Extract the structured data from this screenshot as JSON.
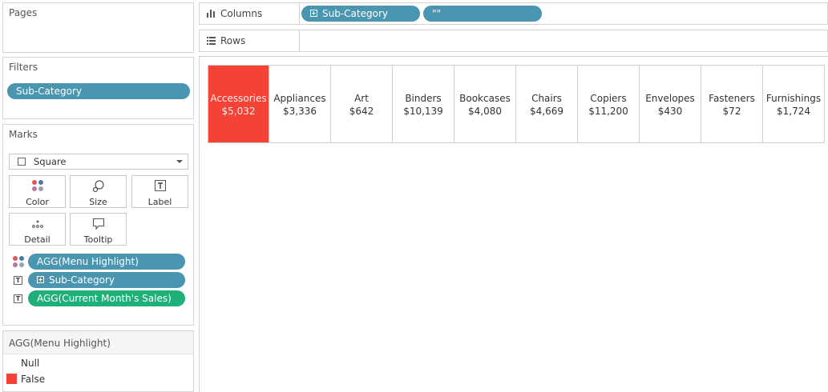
{
  "colors": {
    "pill_blue": "#4a95b0",
    "pill_green": "#1fb079",
    "highlight_red": "#f44336"
  },
  "pages": {
    "title": "Pages"
  },
  "filters": {
    "title": "Filters",
    "pills": [
      {
        "label": "Sub-Category"
      }
    ]
  },
  "marks": {
    "title": "Marks",
    "mark_type": {
      "label": "Square",
      "icon": "square-icon"
    },
    "buttons": [
      {
        "label": "Color",
        "icon": "color-dots-icon"
      },
      {
        "label": "Size",
        "icon": "size-icon"
      },
      {
        "label": "Label",
        "icon": "label-icon"
      },
      {
        "label": "Detail",
        "icon": "detail-icon"
      },
      {
        "label": "Tooltip",
        "icon": "tooltip-icon"
      }
    ],
    "fields": [
      {
        "icon": "color-dots-icon",
        "label": "AGG(Menu Highlight)",
        "color": "#4a95b0"
      },
      {
        "icon": "label-icon",
        "label": "Sub-Category",
        "color": "#4a95b0"
      },
      {
        "icon": "label-icon",
        "label": "AGG(Current Month's Sales)",
        "color": "#1fb079"
      }
    ]
  },
  "legend": {
    "title": "AGG(Menu Highlight)",
    "items": [
      {
        "label": "Null",
        "swatch": ""
      },
      {
        "label": "False",
        "swatch": "#f44336"
      }
    ]
  },
  "shelves": {
    "columns": {
      "label": "Columns",
      "pills": [
        {
          "label": "Sub-Category"
        },
        {
          "label": "\"\""
        }
      ]
    },
    "rows": {
      "label": "Rows"
    }
  },
  "view": {
    "tiles": [
      {
        "name": "Accessories",
        "value": "$5,032",
        "highlight": true
      },
      {
        "name": "Appliances",
        "value": "$3,336",
        "highlight": false
      },
      {
        "name": "Art",
        "value": "$642",
        "highlight": false
      },
      {
        "name": "Binders",
        "value": "$10,139",
        "highlight": false
      },
      {
        "name": "Bookcases",
        "value": "$4,080",
        "highlight": false
      },
      {
        "name": "Chairs",
        "value": "$4,669",
        "highlight": false
      },
      {
        "name": "Copiers",
        "value": "$11,200",
        "highlight": false
      },
      {
        "name": "Envelopes",
        "value": "$430",
        "highlight": false
      },
      {
        "name": "Fasteners",
        "value": "$72",
        "highlight": false
      },
      {
        "name": "Furnishings",
        "value": "$1,724",
        "highlight": false
      }
    ]
  }
}
